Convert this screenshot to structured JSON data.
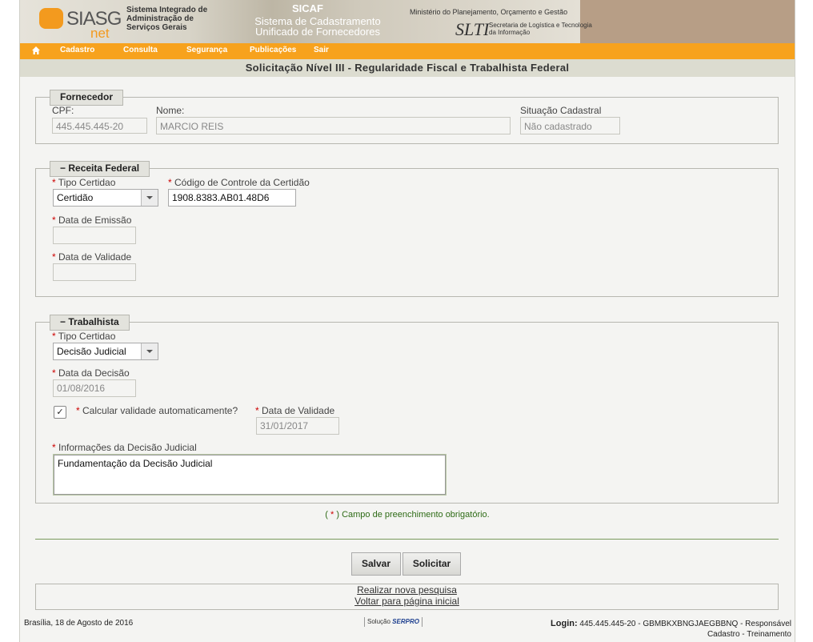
{
  "header": {
    "logo": {
      "main": "SIASG",
      "sub": "net"
    },
    "org_name": "Sistema Integrado de Administração de Serviços Gerais",
    "sicaf_title": "SICAF",
    "sicaf_subtitle": "Sistema de Cadastramento Unificado de Fornecedores",
    "ministry": "Ministério do Planejamento, Orçamento e Gestão",
    "slti_logo": "SLTI",
    "slti_text": "Secretaria de Logística e Tecnologia da Informação"
  },
  "menu": {
    "home_icon": "home-icon",
    "items": [
      "Cadastro",
      "Consulta",
      "Segurança",
      "Publicações",
      "Sair"
    ]
  },
  "page_title": "Solicitação Nível III - Regularidade Fiscal e Trabalhista Federal",
  "fornecedor": {
    "legend": "Fornecedor",
    "cpf_label": "CPF:",
    "cpf_value": "445.445.445-20",
    "nome_label": "Nome:",
    "nome_value": "MARCIO REIS",
    "situacao_label": "Situação Cadastral",
    "situacao_value": "Não cadastrado"
  },
  "receita": {
    "legend": "Receita Federal",
    "toggle": "−",
    "req": "*",
    "tipo_label": "Tipo Certidao",
    "tipo_value": "Certidão",
    "codigo_label": "Código de Controle da Certidão",
    "codigo_value": "1908.8383.AB01.48D6",
    "emissao_label": "Data de Emissão",
    "emissao_value": "",
    "validade_label": "Data de Validade",
    "validade_value": ""
  },
  "trabalhista": {
    "legend": "Trabalhista",
    "toggle": "−",
    "req": "*",
    "tipo_label": "Tipo Certidao",
    "tipo_value": "Decisão Judicial",
    "decisao_label": "Data da Decisão",
    "decisao_value": "01/08/2016",
    "calc_label": "Calcular validade automaticamente?",
    "calc_checked": true,
    "check_mark": "✓",
    "validade_label": "Data de Validade",
    "validade_value": "31/01/2017",
    "info_label": "Informações da Decisão Judicial",
    "info_value": "Fundamentação da Decisão Judicial"
  },
  "required_note": {
    "open": "(",
    "star": "*",
    "text": ") Campo de preenchimento obrigatório."
  },
  "buttons": {
    "salvar": "Salvar",
    "solicitar": "Solicitar"
  },
  "links": {
    "nova_pesquisa": "Realizar nova pesquisa",
    "voltar": "Voltar para página inicial"
  },
  "footer": {
    "date": "Brasília, 18 de Agosto de 2016",
    "serpro_prefix": "Solução",
    "serpro_name": "SERPRO",
    "login_label": "Login:",
    "login_value": "445.445.445-20 - GBMBKXBNGJAEGBBNQ - Responsável",
    "login_line2": "Cadastro - Treinamento"
  }
}
